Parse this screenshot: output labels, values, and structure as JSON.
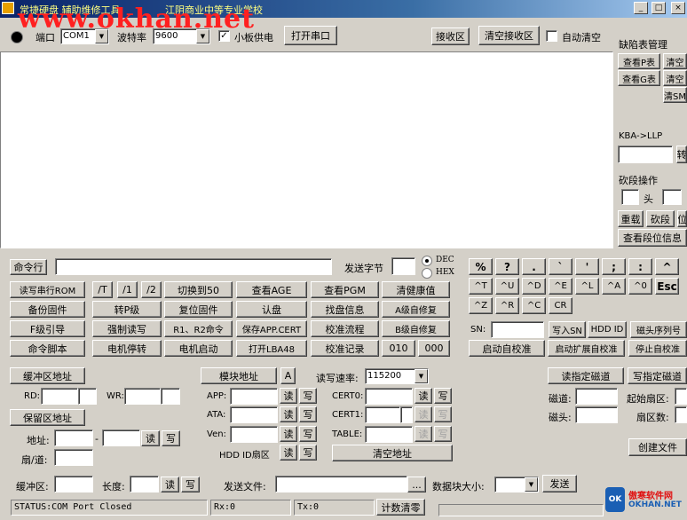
{
  "window": {
    "title": "常捷硬盘 辅助维修工具",
    "school": "江阴商业中等专业学校",
    "watermark": "www.okhan.net",
    "min": "_",
    "max": "□",
    "close": "×"
  },
  "serial": {
    "port_label": "端口",
    "port_value": "COM1",
    "baud_label": "波特率",
    "baud_value": "9600",
    "board_power_label": "小板供电",
    "board_power_checked": true,
    "open_port": "打开串口",
    "receive_area": "接收区",
    "clear_receive": "清空接收区",
    "auto_clear_label": "自动清空",
    "auto_clear_checked": false
  },
  "defect": {
    "title": "缺陷表管理",
    "view_p": "查看P表",
    "clear_1": "清空",
    "view_g": "查看G表",
    "clear_2": "清空",
    "clear_s": "清SM"
  },
  "kba": {
    "label": "KBA->LLP",
    "btn": "转"
  },
  "cut": {
    "title": "砍段操作",
    "head": "头",
    "rebuild": "重载",
    "cut_btn": "砍段",
    "extra": "位",
    "view_info": "查看段位信息"
  },
  "command": {
    "cmd_label": "命令行",
    "cmd_value": "",
    "send_bytes_label": "发送字节",
    "send_bytes_value": "",
    "dec": "DEC",
    "hex": "HEX",
    "dec_selected": true
  },
  "grid": [
    [
      "读写串行ROM",
      "/T",
      "/1",
      "/2",
      "切换到50",
      "查看AGE",
      "查看PGM",
      "清健康值"
    ],
    [
      "备份固件",
      "转P级",
      "复位固件",
      "认盘",
      "找盘信息",
      "A级自修复"
    ],
    [
      "F级引导",
      "强制读写",
      "R1、R2命令",
      "保存APP.CERT",
      "校准流程",
      "B级自修复"
    ],
    [
      "命令脚本",
      "电机停转",
      "电机启动",
      "打开LBA48",
      "校准记录",
      "010",
      "000"
    ]
  ],
  "keys": {
    "row1": [
      "%",
      "?",
      ".",
      "`",
      "'",
      ";",
      ":",
      "^"
    ],
    "row2": [
      "^T",
      "^U",
      "^D",
      "^E",
      "^L",
      "^A",
      "^0",
      "Esc"
    ],
    "row3": [
      "^Z",
      "^R",
      "^C",
      "CR"
    ]
  },
  "sn": {
    "label": "SN:",
    "value": "",
    "write_sn": "写入SN",
    "hdd_id": "HDD ID",
    "head_seq": "磁头序列号"
  },
  "self_cal": {
    "start": "启动自校准",
    "start_ext": "启动扩展自校准",
    "stop": "停止自校准"
  },
  "buffer": {
    "buf_addr": "缓冲区地址",
    "rd_label": "RD:",
    "wr_label": "WR:",
    "reserve_addr": "保留区地址",
    "addr_label": "地址:",
    "dash": "-",
    "read": "读",
    "write": "写",
    "track_label": "扇/道:"
  },
  "module": {
    "addr": "模块地址",
    "a": "A",
    "rw_speed_label": "读写速率:",
    "rw_speed_value": "115200",
    "app": "APP:",
    "ata": "ATA:",
    "ven": "Ven:",
    "hdd_id_area": "HDD ID扇区",
    "cert0": "CERT0:",
    "cert1": "CERT1:",
    "table": "TABLE:",
    "clear_addr": "清空地址"
  },
  "track": {
    "read_track": "读指定磁道",
    "write_track": "写指定磁道",
    "track_label": "磁道:",
    "start_sector": "起始扇区:",
    "head_label": "磁头:",
    "sector_count": "扇区数:",
    "create_file": "创建文件"
  },
  "bottom": {
    "buffer_label": "缓冲区:",
    "length_label": "长度:",
    "read": "读",
    "write": "写",
    "send_file_label": "发送文件:",
    "browse": "...",
    "block_size_label": "数据块大小:",
    "send": "发送"
  },
  "status": {
    "state": "STATUS:COM Port Closed",
    "rx": "Rx:0",
    "tx": "Tx:0",
    "reset_count": "计数清零"
  },
  "logo": {
    "cn": "傲寒软件网",
    "en": "OKHAN.NET",
    "mark": "OK"
  }
}
